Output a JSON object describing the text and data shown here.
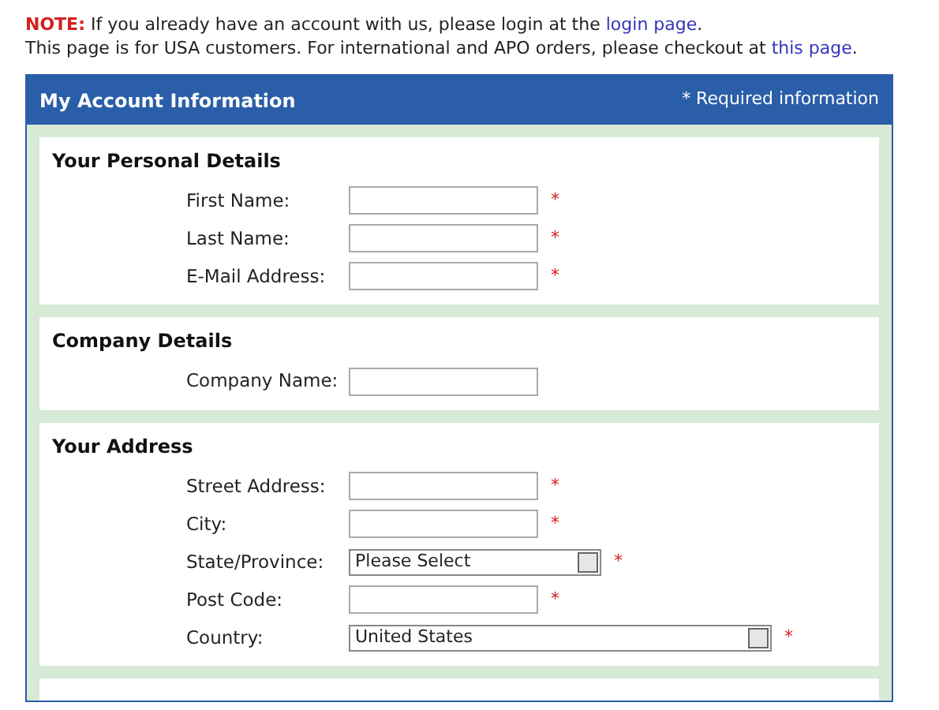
{
  "notice": {
    "label": "NOTE:",
    "line_1": "If you already have an account with us, please login at the",
    "link_1": "login page",
    "line_1_end": ".",
    "line_2": "This page is for USA customers. For international and APO orders, please checkout at",
    "link_2": "this page",
    "line_2_end": "."
  },
  "panel": {
    "title": "My Account Information",
    "required_note": "* Required information"
  },
  "sections": [
    {
      "title": "Your Personal Details",
      "fields": [
        {
          "label": "First Name:",
          "kind": "text",
          "required": true
        },
        {
          "label": "Last Name:",
          "kind": "text",
          "required": true
        },
        {
          "label": "E-Mail Address:",
          "kind": "text",
          "required": true
        }
      ]
    },
    {
      "title": "Company Details",
      "fields": [
        {
          "label": "Company Name:",
          "kind": "text",
          "required": false
        }
      ]
    },
    {
      "title": "Your Address",
      "fields": [
        {
          "label": "Street Address:",
          "kind": "text",
          "required": true
        },
        {
          "label": "City:",
          "kind": "text",
          "required": true
        },
        {
          "label": "State/Province:",
          "kind": "select",
          "value": "Please Select",
          "required": true
        },
        {
          "label": "Post Code:",
          "kind": "text",
          "required": true
        },
        {
          "label": "Country:",
          "kind": "select",
          "value": "United States",
          "required": true
        }
      ]
    }
  ],
  "required_mark": "*"
}
